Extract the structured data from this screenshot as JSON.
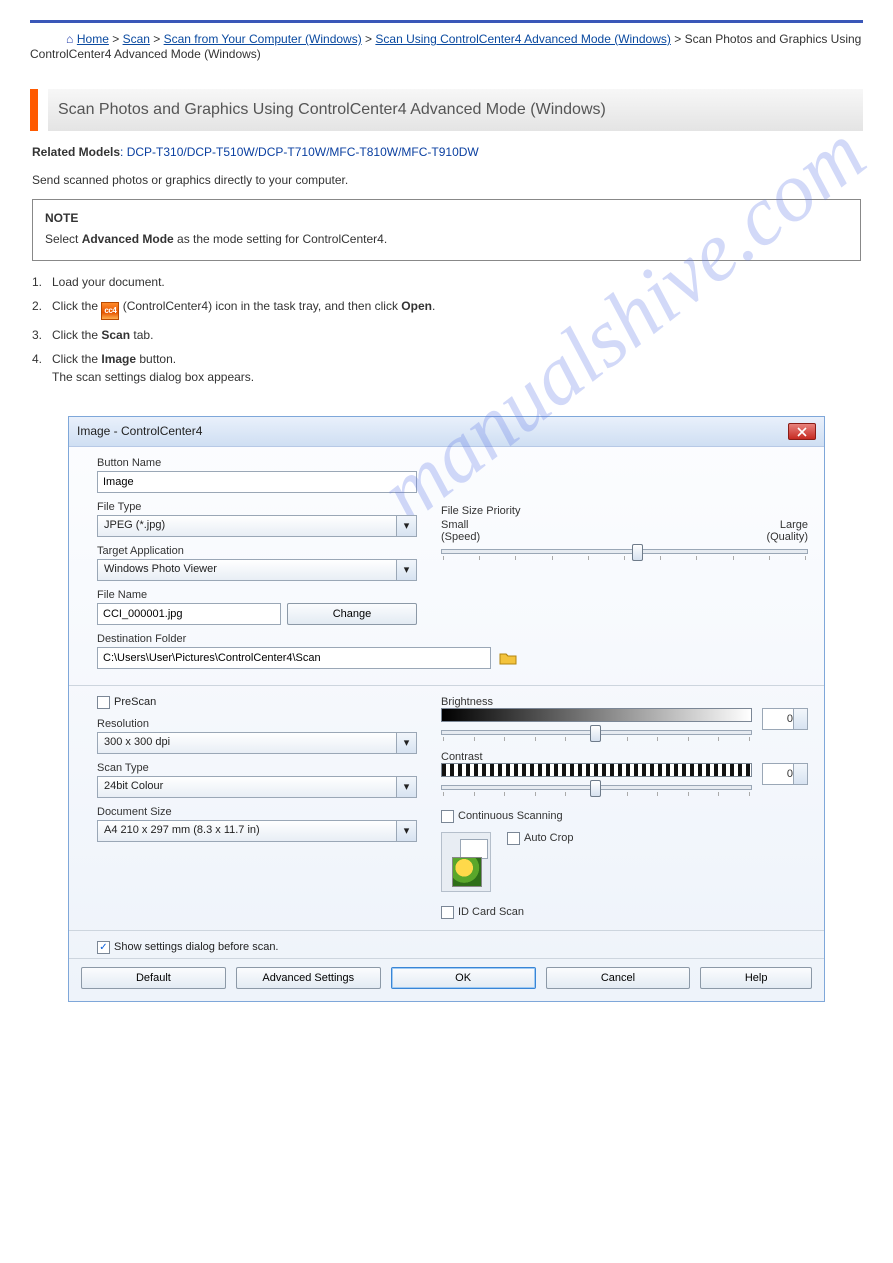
{
  "header": {
    "home_link": "Home",
    "crumb_sep": ">",
    "crumb1": "Scan",
    "crumb2": "Scan from Your Computer (Windows)",
    "crumb3": "Scan Using ControlCenter4 Advanced Mode (Windows)",
    "crumb4": "Scan Photos and Graphics Using ControlCenter4 Advanced Mode (Windows)"
  },
  "title": "Scan Photos and Graphics Using ControlCenter4 Advanced Mode (Windows)",
  "models_label": "Related Models",
  "models": ": DCP-T310/DCP-T510W/DCP-T710W/MFC-T810W/MFC-T910DW",
  "lead": "Send scanned photos or graphics directly to your computer.",
  "note_title": "NOTE",
  "note_body_a": "Select ",
  "note_body_b": "Advanced Mode",
  "note_body_c": " as the mode setting for ControlCenter4.",
  "steps": {
    "s1a": "Load your document.",
    "s2a": "Click the ",
    "s2b": " (ControlCenter4) icon in the task tray, and then click ",
    "s2c": "Open",
    "s2d": ".",
    "s3a": "Click the ",
    "s3b": "Scan",
    "s3c": " tab.",
    "s4a": "Click the ",
    "s4b": "Image",
    "s4c": " button.",
    "s4d": "The scan settings dialog box appears."
  },
  "dlg": {
    "title": "Image - ControlCenter4",
    "button_name_label": "Button Name",
    "button_name_value": "Image",
    "file_type_label": "File Type",
    "file_type_value": "JPEG (*.jpg)",
    "target_app_label": "Target Application",
    "target_app_value": "Windows Photo Viewer",
    "file_name_label": "File Name",
    "file_name_value": "CCI_000001.jpg",
    "change_btn": "Change",
    "dest_label": "Destination Folder",
    "dest_value": "C:\\Users\\User\\Pictures\\ControlCenter4\\Scan",
    "fs_priority_label": "File Size Priority",
    "fs_small": "Small",
    "fs_large": "Large",
    "fs_speed": "(Speed)",
    "fs_quality": "(Quality)",
    "prescan": "PreScan",
    "resolution_label": "Resolution",
    "resolution_value": "300 x 300 dpi",
    "scan_type_label": "Scan Type",
    "scan_type_value": "24bit Colour",
    "doc_size_label": "Document Size",
    "doc_size_value": "A4 210 x 297 mm (8.3 x 11.7 in)",
    "brightness_label": "Brightness",
    "brightness_value": "0",
    "contrast_label": "Contrast",
    "contrast_value": "0",
    "continuous": "Continuous Scanning",
    "auto_crop": "Auto Crop",
    "id_card": "ID Card Scan",
    "show_settings": "Show settings dialog before scan.",
    "btn_default": "Default",
    "btn_adv": "Advanced Settings",
    "btn_ok": "OK",
    "btn_cancel": "Cancel",
    "btn_help": "Help"
  }
}
